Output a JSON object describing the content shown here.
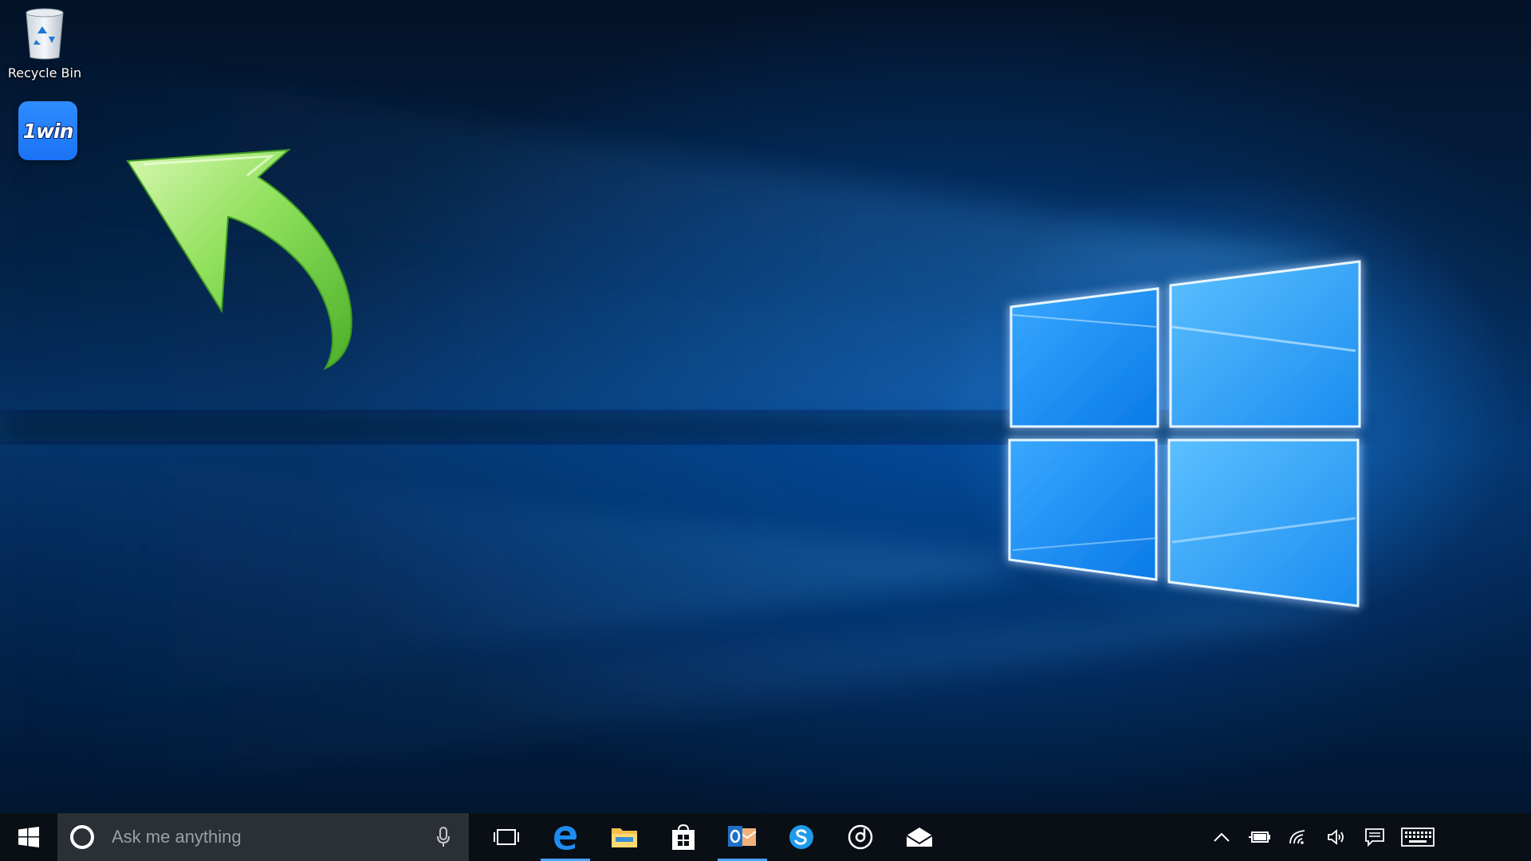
{
  "desktop": {
    "icons": [
      {
        "label": "Recycle Bin",
        "icon": "recycle-bin-icon"
      },
      {
        "label": "",
        "icon": "1win-app-icon",
        "tile_text": "1win",
        "tile_color": "#1a73f5"
      }
    ],
    "annotation": {
      "type": "curved-arrow",
      "color": "#7ed957",
      "direction": "up-left"
    }
  },
  "taskbar": {
    "background": "#0a0f16",
    "search": {
      "placeholder": "Ask me anything"
    },
    "pinned": [
      {
        "name": "task-view",
        "icon": "task-view-icon",
        "running": false
      },
      {
        "name": "edge",
        "icon": "edge-icon",
        "running": true
      },
      {
        "name": "file-explorer",
        "icon": "folder-icon",
        "running": false
      },
      {
        "name": "store",
        "icon": "store-icon",
        "running": false
      },
      {
        "name": "outlook",
        "icon": "outlook-icon",
        "running": true
      },
      {
        "name": "skype",
        "icon": "skype-icon",
        "running": false
      },
      {
        "name": "groove-music",
        "icon": "music-icon",
        "running": false
      },
      {
        "name": "mail",
        "icon": "mail-icon",
        "running": false
      }
    ],
    "tray": [
      "chevron-up-icon",
      "battery-icon",
      "wifi-icon",
      "volume-icon",
      "action-center-icon",
      "keyboard-icon"
    ],
    "accent": "#4aa3ff"
  }
}
